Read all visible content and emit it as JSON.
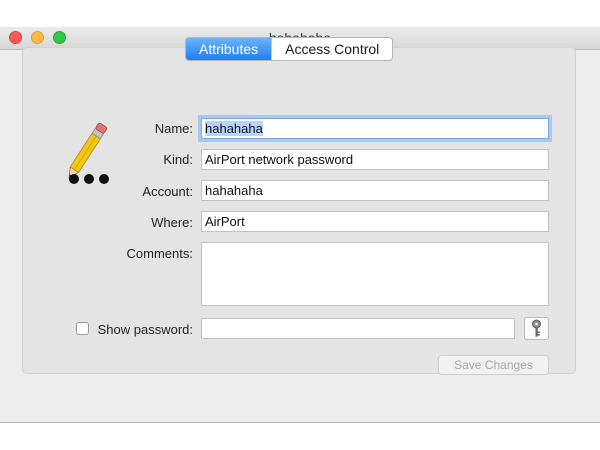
{
  "window": {
    "title": "hahahaha"
  },
  "tabs": [
    {
      "label": "Attributes",
      "active": true
    },
    {
      "label": "Access Control",
      "active": false
    }
  ],
  "form": {
    "name_label": "Name:",
    "name_value": "hahahaha",
    "kind_label": "Kind:",
    "kind_value": "AirPort network password",
    "account_label": "Account:",
    "account_value": "hahahaha",
    "where_label": "Where:",
    "where_value": "AirPort",
    "comments_label": "Comments:",
    "comments_value": "",
    "show_password_label": "Show password:",
    "show_password_checked": false,
    "password_value": ""
  },
  "buttons": {
    "save_label": "Save Changes",
    "save_enabled": false
  },
  "icons": {
    "item": "pencil-dots-icon",
    "key": "key-icon"
  },
  "colors": {
    "tab_active": "#1b80f1",
    "close": "#fc5b57",
    "minimize": "#fdbc40",
    "maximize": "#34c84a"
  }
}
